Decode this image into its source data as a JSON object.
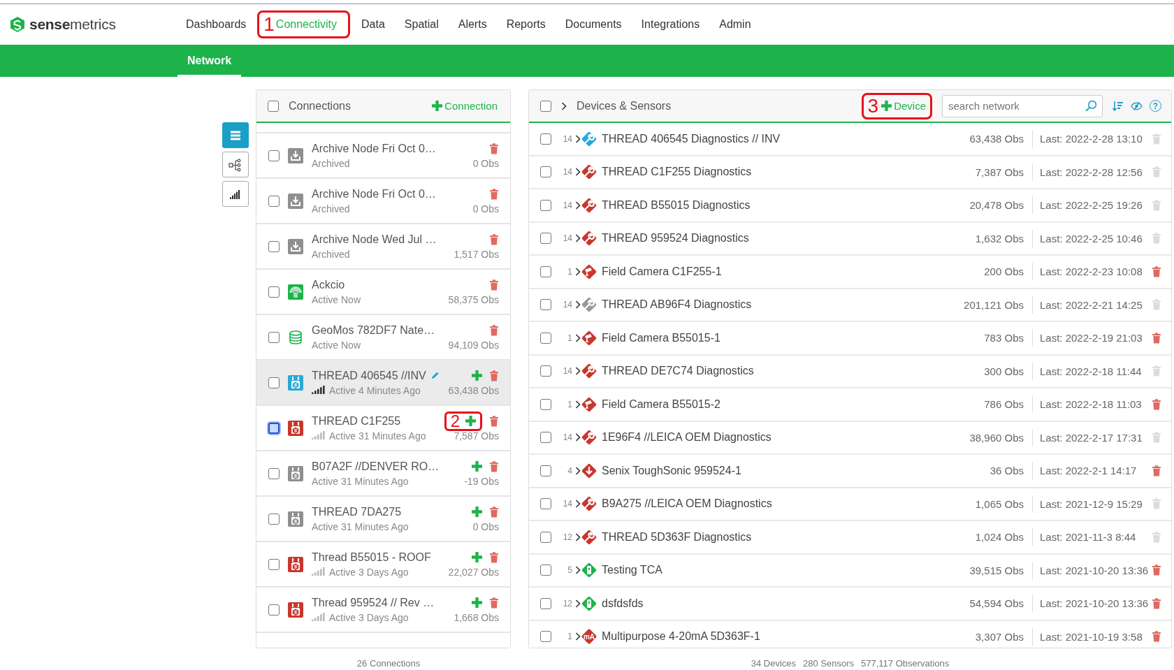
{
  "brand": {
    "logo_text": "**sense**metrics"
  },
  "nav": [
    {
      "label": "Dashboards",
      "selected": false
    },
    {
      "label": "Connectivity",
      "selected": true,
      "callout": "1"
    },
    {
      "label": "Data",
      "selected": false
    },
    {
      "label": "Spatial",
      "selected": false
    },
    {
      "label": "Alerts",
      "selected": false
    },
    {
      "label": "Reports",
      "selected": false
    },
    {
      "label": "Documents",
      "selected": false
    },
    {
      "label": "Integrations",
      "selected": false
    },
    {
      "label": "Admin",
      "selected": false
    }
  ],
  "subnav": [
    {
      "label": "Network",
      "selected": true
    }
  ],
  "view_tools": [
    {
      "kind": "list",
      "selected": true
    },
    {
      "kind": "tree",
      "selected": false
    },
    {
      "kind": "signal",
      "selected": false
    }
  ],
  "connections": {
    "title": "Connections",
    "checked": false,
    "add_label": "Connection",
    "footer": "26 Connections",
    "rows": [
      {
        "name": "Archive Node Fri Oct 0…",
        "status": "Archived",
        "obs": "0 Obs",
        "kind": "archive",
        "color": "#8f8f8f",
        "add": false,
        "editable": false,
        "selected": false,
        "focused": false
      },
      {
        "name": "Archive Node Fri Oct 0…",
        "status": "Archived",
        "obs": "0 Obs",
        "kind": "archive",
        "color": "#8f8f8f",
        "add": false,
        "editable": false,
        "selected": false,
        "focused": false
      },
      {
        "name": "Archive Node Wed Jul …",
        "status": "Archived",
        "obs": "1,517 Obs",
        "kind": "archive",
        "color": "#8f8f8f",
        "add": false,
        "editable": false,
        "selected": false,
        "focused": false
      },
      {
        "name": "Ackcio",
        "status": "Active Now",
        "obs": "58,375 Obs",
        "kind": "radio",
        "color": "#1db34a",
        "add": false,
        "editable": false,
        "selected": false,
        "focused": false
      },
      {
        "name": "GeoMos 782DF7 Nate…",
        "status": "Active Now",
        "obs": "94,109 Obs",
        "kind": "database",
        "color": "#1db34a",
        "add": false,
        "editable": false,
        "selected": false,
        "focused": false
      },
      {
        "name": "THREAD 406545 //INV",
        "status": "Active 4 Minutes Ago",
        "obs": "63,438 Obs",
        "kind": "thread",
        "color": "#29a8d8",
        "signal": {
          "active": true
        },
        "add": true,
        "editable": true,
        "selected": true,
        "focused": false
      },
      {
        "name": "THREAD C1F255",
        "status": "Active 31 Minutes Ago",
        "obs": "7,587 Obs",
        "kind": "thread",
        "color": "#c8372d",
        "signal": {
          "active": false
        },
        "add": true,
        "editable": false,
        "selected": false,
        "focused": true,
        "callout": "2"
      },
      {
        "name": "B07A2F //DENVER RO…",
        "status": "Active 31 Minutes Ago",
        "obs": "-19 Obs",
        "kind": "thread",
        "color": "#8f8f8f",
        "add": true,
        "editable": false,
        "selected": false,
        "focused": false
      },
      {
        "name": "THREAD 7DA275",
        "status": "Active 31 Minutes Ago",
        "obs": "0 Obs",
        "kind": "thread",
        "color": "#8f8f8f",
        "add": true,
        "editable": false,
        "selected": false,
        "focused": false
      },
      {
        "name": "Thread B55015 - ROOF",
        "status": "Active 3 Days Ago",
        "obs": "22,027 Obs",
        "kind": "thread",
        "color": "#c8372d",
        "signal": {
          "active": false
        },
        "add": true,
        "editable": false,
        "selected": false,
        "focused": false
      },
      {
        "name": "Thread 959524 // Rev …",
        "status": "Active 3 Days Ago",
        "obs": "1,668 Obs",
        "kind": "thread",
        "color": "#c8372d",
        "signal": {
          "active": false
        },
        "add": true,
        "editable": false,
        "selected": false,
        "focused": false
      }
    ]
  },
  "devices": {
    "title": "Devices & Sensors",
    "checked": false,
    "add_label": "Device",
    "add_callout": "3",
    "search": {
      "placeholder": "search network"
    },
    "help": "?",
    "footer": [
      "34 Devices",
      "280 Sensors",
      "577,117 Observations"
    ],
    "rows": [
      {
        "count": "14",
        "name": "THREAD 406545 Diagnostics // INV",
        "kind": "wrench",
        "color": "#29a8d8",
        "obs": "63,438 Obs",
        "last": "Last: 2022-2-28 13:10",
        "deletable": false,
        "checked": false
      },
      {
        "count": "14",
        "name": "THREAD C1F255 Diagnostics",
        "kind": "wrench",
        "color": "#c8372d",
        "obs": "7,387 Obs",
        "last": "Last: 2022-2-28 12:56",
        "deletable": false,
        "checked": false
      },
      {
        "count": "14",
        "name": "THREAD B55015 Diagnostics",
        "kind": "wrench",
        "color": "#c8372d",
        "obs": "20,478 Obs",
        "last": "Last: 2022-2-25 19:26",
        "deletable": false,
        "checked": false
      },
      {
        "count": "14",
        "name": "THREAD 959524 Diagnostics",
        "kind": "wrench",
        "color": "#c8372d",
        "obs": "1,632 Obs",
        "last": "Last: 2022-2-25 10:46",
        "deletable": false,
        "checked": false
      },
      {
        "count": "1",
        "name": "Field Camera C1F255-1",
        "kind": "camera",
        "color": "#c8372d",
        "obs": "200 Obs",
        "last": "Last: 2022-2-23 10:08",
        "deletable": true,
        "checked": false
      },
      {
        "count": "14",
        "name": "THREAD AB96F4 Diagnostics",
        "kind": "wrench",
        "color": "#999999",
        "obs": "201,121 Obs",
        "last": "Last: 2022-2-21 14:25",
        "deletable": false,
        "checked": false
      },
      {
        "count": "1",
        "name": "Field Camera B55015-1",
        "kind": "camera",
        "color": "#c8372d",
        "obs": "783 Obs",
        "last": "Last: 2022-2-19 21:03",
        "deletable": true,
        "checked": false
      },
      {
        "count": "14",
        "name": "THREAD DE7C74 Diagnostics",
        "kind": "wrench",
        "color": "#c8372d",
        "obs": "300 Obs",
        "last": "Last: 2022-2-18 11:44",
        "deletable": false,
        "checked": false
      },
      {
        "count": "1",
        "name": "Field Camera B55015-2",
        "kind": "camera",
        "color": "#c8372d",
        "obs": "786 Obs",
        "last": "Last: 2022-2-18 11:03",
        "deletable": true,
        "checked": false
      },
      {
        "count": "14",
        "name": "1E96F4 //LEICA OEM Diagnostics",
        "kind": "wrench",
        "color": "#c8372d",
        "obs": "38,960 Obs",
        "last": "Last: 2022-2-17 17:31",
        "deletable": false,
        "checked": false
      },
      {
        "count": "4",
        "name": "Senix ToughSonic 959524-1",
        "kind": "arrow",
        "color": "#c8372d",
        "obs": "36 Obs",
        "last": "Last: 2022-2-1 14:17",
        "deletable": true,
        "checked": false
      },
      {
        "count": "14",
        "name": "B9A275 //LEICA OEM Diagnostics",
        "kind": "wrench",
        "color": "#c8372d",
        "obs": "1,065 Obs",
        "last": "Last: 2021-12-9 15:29",
        "deletable": false,
        "checked": false
      },
      {
        "count": "12",
        "name": "THREAD 5D363F Diagnostics",
        "kind": "wrench",
        "color": "#c8372d",
        "obs": "1,024 Obs",
        "last": "Last: 2021-11-3 8:44",
        "deletable": false,
        "checked": false
      },
      {
        "count": "5",
        "name": "Testing TCA",
        "kind": "battery",
        "color": "#1db34a",
        "obs": "39,515 Obs",
        "last": "Last: 2021-10-20 13:36",
        "deletable": true,
        "checked": false
      },
      {
        "count": "12",
        "name": "dsfdsfds",
        "kind": "battery",
        "color": "#1db34a",
        "obs": "54,594 Obs",
        "last": "Last: 2021-10-20 13:36",
        "deletable": true,
        "checked": false
      },
      {
        "count": "1",
        "name": "Multipurpose 4-20mA 5D363F-1",
        "kind": "label",
        "icon_label": "mA",
        "color": "#c8372d",
        "obs": "3,307 Obs",
        "last": "Last: 2021-10-19 3:58",
        "deletable": true,
        "checked": false
      }
    ]
  }
}
